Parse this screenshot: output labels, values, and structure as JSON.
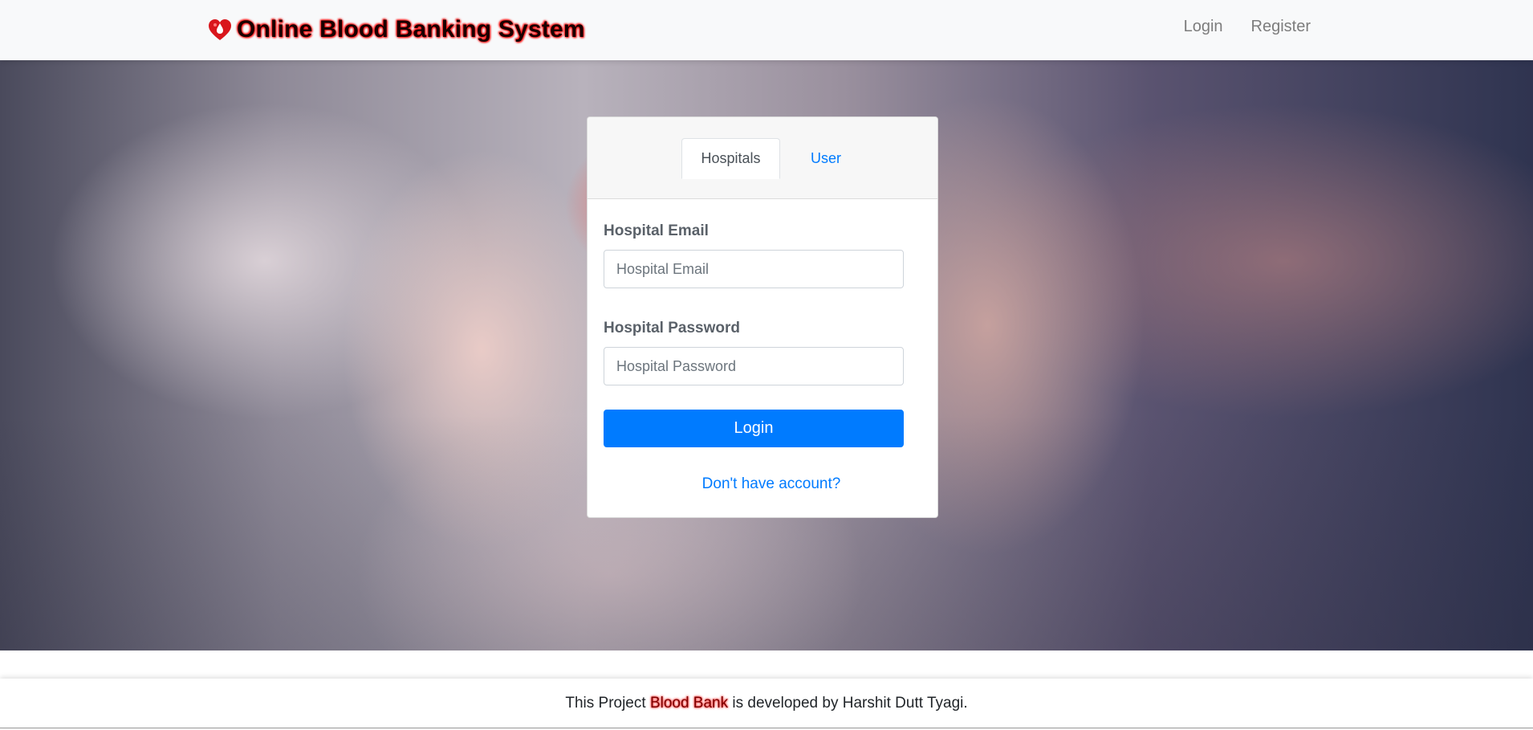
{
  "navbar": {
    "brand_icon": "heart-drop-icon",
    "brand_title": "Online Blood Banking System",
    "links": [
      {
        "label": "Login"
      },
      {
        "label": "Register"
      }
    ]
  },
  "hero": {
    "background": "hands-holding-heart-photo"
  },
  "login_card": {
    "tabs": [
      {
        "label": "Hospitals",
        "active": true
      },
      {
        "label": "User",
        "active": false
      }
    ],
    "email_label": "Hospital Email",
    "email_placeholder": "Hospital Email",
    "email_value": "",
    "password_label": "Hospital Password",
    "password_placeholder": "Hospital Password",
    "password_value": "",
    "submit_label": "Login",
    "signup_link": "Don't have account?"
  },
  "footer": {
    "prefix": "This Project ",
    "highlight": "Blood Bank",
    "suffix": " is developed by Harshit Dutt Tyagi."
  },
  "colors": {
    "primary": "#007bff",
    "brand_glow": "#ff0000",
    "navbar_bg": "#f8f9fa"
  }
}
